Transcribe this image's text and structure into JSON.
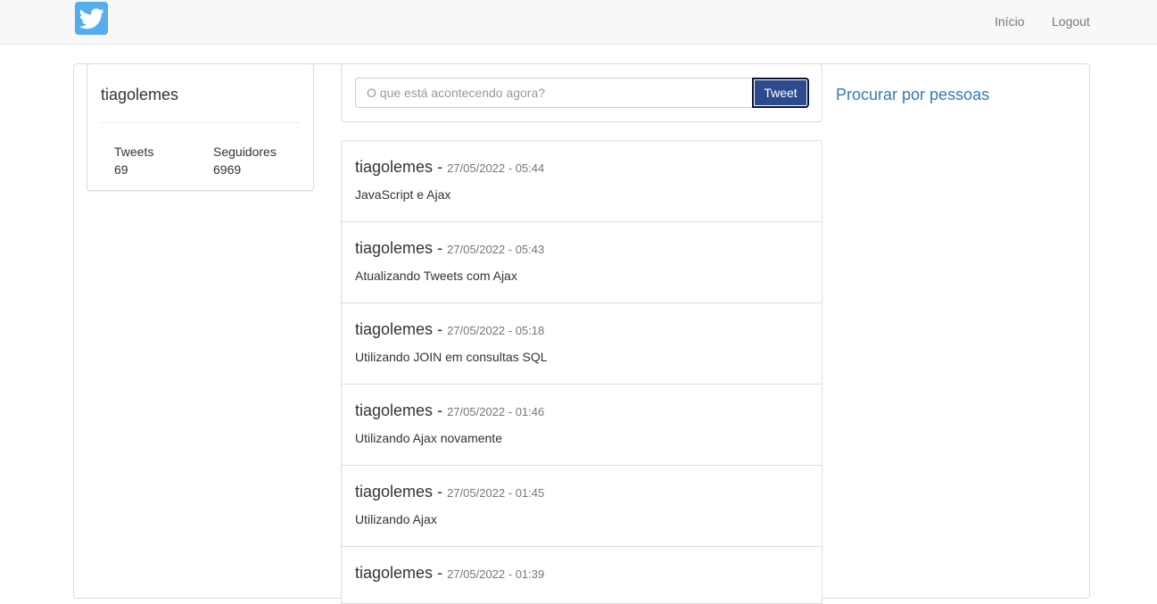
{
  "navbar": {
    "logo_icon": "twitter-bird-icon",
    "links": [
      "Início",
      "Logout"
    ]
  },
  "profile": {
    "username": "tiagolemes",
    "stats": [
      {
        "label": "Tweets",
        "value": "69"
      },
      {
        "label": "Seguidores",
        "value": "6969"
      }
    ]
  },
  "tweet_form": {
    "placeholder": "O que está acontecendo agora?",
    "button_label": "Tweet"
  },
  "tweets": [
    {
      "author": "tiagolemes",
      "separator": "-",
      "date": "27/05/2022 - 05:44",
      "text": "JavaScript e Ajax"
    },
    {
      "author": "tiagolemes",
      "separator": "-",
      "date": "27/05/2022 - 05:43",
      "text": "Atualizando Tweets com Ajax"
    },
    {
      "author": "tiagolemes",
      "separator": "-",
      "date": "27/05/2022 - 05:18",
      "text": "Utilizando JOIN em consultas SQL"
    },
    {
      "author": "tiagolemes",
      "separator": "-",
      "date": "27/05/2022 - 01:46",
      "text": "Utilizando Ajax novamente"
    },
    {
      "author": "tiagolemes",
      "separator": "-",
      "date": "27/05/2022 - 01:45",
      "text": "Utilizando Ajax"
    },
    {
      "author": "tiagolemes",
      "separator": "-",
      "date": "27/05/2022 - 01:39",
      "text": ""
    }
  ],
  "sidebar": {
    "search_link": "Procurar por pessoas"
  },
  "colors": {
    "navbar_bg": "#f8f8f8",
    "logo_bg": "#55acee",
    "button_bg": "#2e4a8f",
    "link": "#337ab7"
  }
}
